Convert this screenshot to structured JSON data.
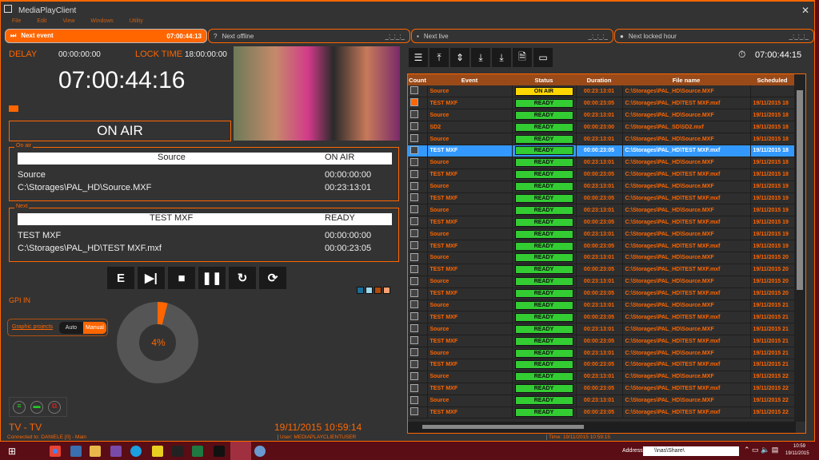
{
  "app": {
    "title": "MediaPlayClient",
    "menu": [
      "File",
      "Edit",
      "View",
      "Windows",
      "Utility"
    ]
  },
  "next_bar": [
    {
      "label": "Next event",
      "value": "07:00:44:13",
      "icon": "skip-next-icon",
      "active": true
    },
    {
      "label": "Next offline",
      "value": "_:_:_:_",
      "icon": "question-icon"
    },
    {
      "label": "Next live",
      "value": "_:_:_:_",
      "icon": "camera-icon"
    },
    {
      "label": "Next locked hour",
      "value": "_:_:_:_",
      "icon": "lock-icon"
    }
  ],
  "left": {
    "delay_label": "DELAY",
    "delay": "00:00:00:00",
    "lock_label": "LOCK TIME",
    "lock": "18:00:00:00",
    "timecode": "07:00:44:16",
    "status": "ON AIR",
    "on_air": {
      "title": "On air",
      "name": "Source",
      "state": "ON AIR",
      "event": "Source",
      "tc": "00:00:00:00",
      "file": "C:\\Storages\\PAL_HD\\Source.MXF",
      "dur": "00:23:13:01"
    },
    "next": {
      "title": "Next",
      "name": "TEST MXF",
      "state": "READY",
      "event": "TEST MXF",
      "tc": "00:00:00:00",
      "file": "C:\\Storages\\PAL_HD\\TEST MXF.mxf",
      "dur": "00:00:23:05"
    },
    "transport": [
      {
        "n": "event-button",
        "g": "E"
      },
      {
        "n": "skip-next-button",
        "g": "▶|"
      },
      {
        "n": "stop-button",
        "g": "■"
      },
      {
        "n": "pause-button",
        "g": "❚❚"
      },
      {
        "n": "loop-button",
        "g": "↻"
      },
      {
        "n": "refresh-button",
        "g": "⟳"
      }
    ],
    "gpi": "GPI IN",
    "graphic_projects": "Graphic projects",
    "auto": "Auto",
    "manual": "Manual",
    "progress_percent": 4,
    "progress_label": "4%",
    "channel": "TV - TV",
    "connected": "Connected to: DANIELE [0] - Main",
    "datetime": "19/11/2015 10:59:14",
    "user": "User:  MEDIAPLAYCLIENTUSER",
    "themes": [
      "#1a6f9a",
      "#9fd8f0",
      "#b04a08",
      "#ffa070"
    ]
  },
  "right": {
    "clock": "07:00:44:15",
    "tools": [
      "database-icon",
      "move-top-icon",
      "move-updown-icon",
      "download-icon",
      "download-bar-icon",
      "file-search-icon",
      "tv-search-icon"
    ],
    "columns": [
      "Count",
      "Event",
      "Status",
      "Duration",
      "File name",
      "Scheduled"
    ],
    "rows": [],
    "time": "Time: 19/11/2015 10:59:15"
  },
  "taskbar": {
    "address_label": "Address",
    "address": "\\\\nas\\Share\\",
    "time": "10:59",
    "date": "19/11/2015"
  },
  "colors": {
    "accent": "#ff6600",
    "ready": "#33cc33",
    "on_air": "#ffd700",
    "selected": "#3399ff"
  }
}
